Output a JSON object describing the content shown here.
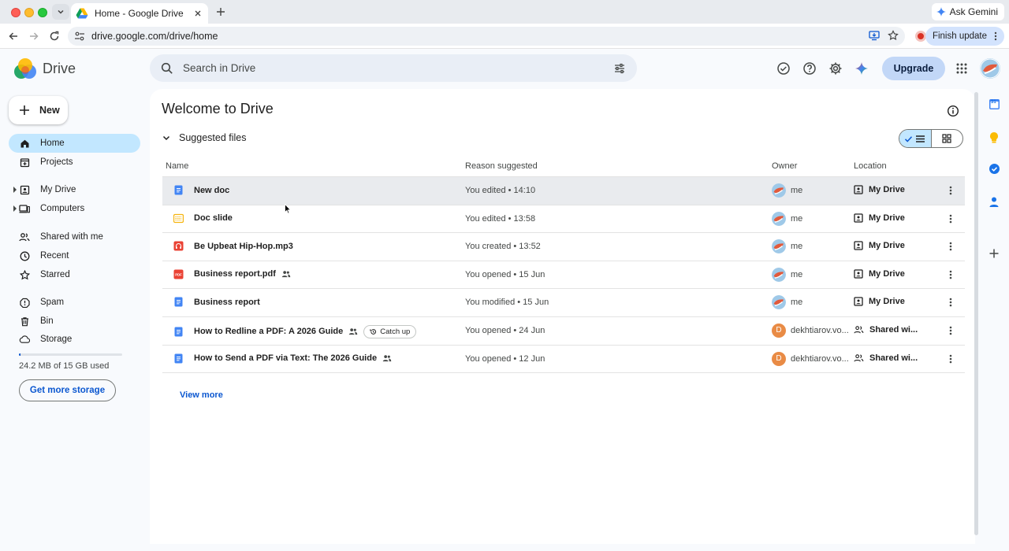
{
  "browser": {
    "tab_title": "Home - Google Drive",
    "url": "drive.google.com/drive/home",
    "ask_gemini": "Ask Gemini",
    "finish_update": "Finish update"
  },
  "app": {
    "name": "Drive",
    "search_placeholder": "Search in Drive",
    "upgrade_label": "Upgrade",
    "new_label": "New"
  },
  "sidebar": {
    "items": [
      {
        "label": "Home",
        "icon": "home-icon",
        "active": true
      },
      {
        "label": "Projects",
        "icon": "projects-icon"
      },
      {
        "label": "My Drive",
        "icon": "my-drive-icon"
      },
      {
        "label": "Computers",
        "icon": "computers-icon"
      },
      {
        "label": "Shared with me",
        "icon": "shared-icon"
      },
      {
        "label": "Recent",
        "icon": "clock-icon"
      },
      {
        "label": "Starred",
        "icon": "star-icon"
      },
      {
        "label": "Spam",
        "icon": "spam-icon"
      },
      {
        "label": "Bin",
        "icon": "bin-icon"
      },
      {
        "label": "Storage",
        "icon": "cloud-icon"
      }
    ],
    "storage_text": "24.2 MB of 15 GB used",
    "storage_used_fraction": 0.0016,
    "get_more_storage": "Get more storage"
  },
  "main": {
    "title": "Welcome to Drive",
    "section_title": "Suggested files",
    "columns": {
      "name": "Name",
      "reason": "Reason suggested",
      "owner": "Owner",
      "location": "Location"
    },
    "files": [
      {
        "name": "New doc",
        "type": "doc",
        "shared": false,
        "reason": "You edited • 14:10",
        "owner": "me",
        "location": "My Drive"
      },
      {
        "name": "Doc slide",
        "type": "slides",
        "shared": false,
        "reason": "You edited • 13:58",
        "owner": "me",
        "location": "My Drive"
      },
      {
        "name": "Be Upbeat Hip-Hop.mp3",
        "type": "audio",
        "shared": false,
        "reason": "You created • 13:52",
        "owner": "me",
        "location": "My Drive"
      },
      {
        "name": "Business report.pdf",
        "type": "pdf",
        "shared": true,
        "reason": "You opened • 15 Jun",
        "owner": "me",
        "location": "My Drive"
      },
      {
        "name": "Business report",
        "type": "doc",
        "shared": false,
        "reason": "You modified • 15 Jun",
        "owner": "me",
        "location": "My Drive"
      },
      {
        "name": "How to Redline a PDF: A 2026 Guide",
        "type": "doc",
        "shared": true,
        "badge": "Catch up",
        "reason": "You opened • 24 Jun",
        "owner": "dekhtiarov.vo...",
        "location": "Shared wi..."
      },
      {
        "name": "How to Send a PDF via Text: The 2026 Guide",
        "type": "doc",
        "shared": true,
        "reason": "You opened • 12 Jun",
        "owner": "dekhtiarov.vo...",
        "location": "Shared wi..."
      }
    ],
    "view_more": "View more",
    "owner_initial": "D",
    "pdf_icon_text": "PDF"
  },
  "side_panel": {
    "calendar_day": "31"
  },
  "colors": {
    "accent": "#0b57d0",
    "active_nav": "#c2e7ff",
    "doc_blue": "#4285f4",
    "slides_yellow": "#f6b40e",
    "pdf_red": "#ea4335"
  }
}
